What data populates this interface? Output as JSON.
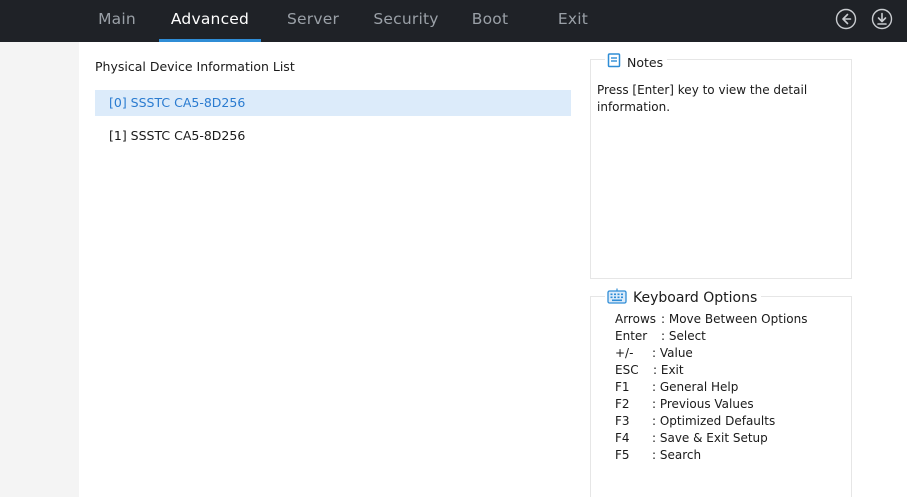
{
  "tabs": [
    {
      "label": "Main",
      "active": false
    },
    {
      "label": "Advanced",
      "active": true
    },
    {
      "label": "Server",
      "active": false
    },
    {
      "label": "Security",
      "active": false
    },
    {
      "label": "Boot",
      "active": false
    },
    {
      "label": "Exit",
      "active": false
    }
  ],
  "nav_icons": [
    "back-arrow-icon",
    "download-icon"
  ],
  "accent_color": "#2f8dd6",
  "selected_color": "#2a7bd0",
  "content": {
    "title": "Physical Device Information List",
    "devices": [
      {
        "label": "[0] SSSTC CA5-8D256",
        "selected": true
      },
      {
        "label": "[1] SSSTC CA5-8D256",
        "selected": false
      }
    ]
  },
  "notes": {
    "title": "Notes",
    "text": "Press [Enter] key to view the detail information."
  },
  "keyboard": {
    "title": "Keyboard Options",
    "items": [
      {
        "key": "Arrows",
        "desc": ": Move Between Options"
      },
      {
        "key": "Enter",
        "desc": ": Select"
      },
      {
        "key": "+/-",
        "desc": ": Value"
      },
      {
        "key": "ESC",
        "desc": ": Exit"
      },
      {
        "key": "F1",
        "desc": ": General Help"
      },
      {
        "key": "F2",
        "desc": ": Previous Values"
      },
      {
        "key": "F3",
        "desc": ": Optimized Defaults"
      },
      {
        "key": "F4",
        "desc": ": Save & Exit Setup"
      },
      {
        "key": "F5",
        "desc": ": Search"
      }
    ]
  }
}
